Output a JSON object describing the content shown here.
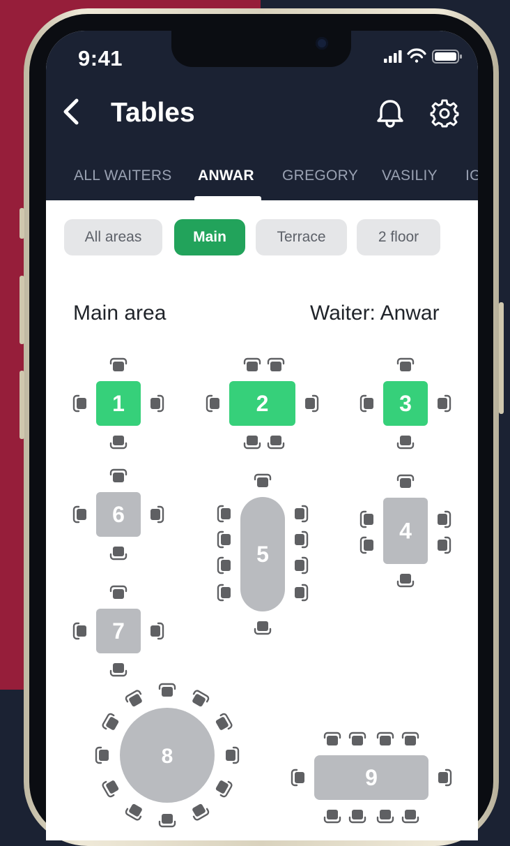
{
  "status_bar": {
    "time": "9:41",
    "signal_icon": "cellular-signal-icon",
    "wifi_icon": "wifi-icon",
    "battery_icon": "battery-icon"
  },
  "header": {
    "title": "Tables",
    "back_icon": "chevron-left-icon",
    "notifications_icon": "bell-icon",
    "settings_icon": "gear-icon"
  },
  "waiter_tabs": [
    {
      "label": "ALL WAITERS",
      "active": false
    },
    {
      "label": "ANWAR",
      "active": true
    },
    {
      "label": "GREGORY",
      "active": false
    },
    {
      "label": "VASILIY",
      "active": false
    },
    {
      "label": "IGOR",
      "active": false
    }
  ],
  "area_filters": [
    {
      "label": "All areas",
      "active": false
    },
    {
      "label": "Main",
      "active": true
    },
    {
      "label": "Terrace",
      "active": false
    },
    {
      "label": "2 floor",
      "active": false
    }
  ],
  "section": {
    "area_title": "Main area",
    "waiter_label": "Waiter: Anwar"
  },
  "colors": {
    "header_bg": "#1b2233",
    "accent_green": "#22a35b",
    "assigned_table": "#36d07a",
    "unassigned_table": "#b9bbbf",
    "chair": "#5f6063"
  },
  "tables": [
    {
      "number": "1",
      "assigned": true
    },
    {
      "number": "2",
      "assigned": true
    },
    {
      "number": "3",
      "assigned": true
    },
    {
      "number": "6",
      "assigned": false
    },
    {
      "number": "5",
      "assigned": false
    },
    {
      "number": "4",
      "assigned": false
    },
    {
      "number": "7",
      "assigned": false
    },
    {
      "number": "8",
      "assigned": false
    },
    {
      "number": "9",
      "assigned": false
    }
  ]
}
